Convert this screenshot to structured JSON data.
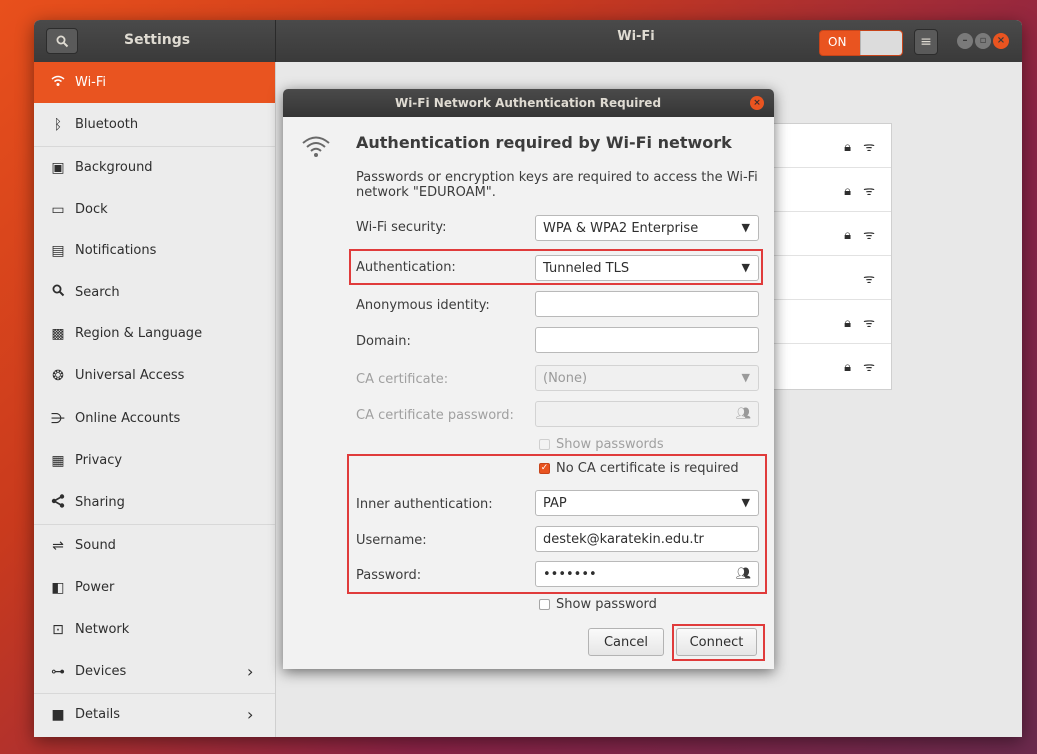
{
  "header": {
    "app_title": "Settings",
    "page_title": "Wi-Fi",
    "switch_label": "ON"
  },
  "sidebar": {
    "items": [
      {
        "label": "Wi-Fi",
        "icon": "wifi-icon"
      },
      {
        "label": "Bluetooth",
        "icon": "bluetooth-icon"
      },
      {
        "label": "Background",
        "icon": "background-icon"
      },
      {
        "label": "Dock",
        "icon": "dock-icon"
      },
      {
        "label": "Notifications",
        "icon": "notifications-icon"
      },
      {
        "label": "Search",
        "icon": "search-icon"
      },
      {
        "label": "Region & Language",
        "icon": "region-icon"
      },
      {
        "label": "Universal Access",
        "icon": "universal-access-icon"
      },
      {
        "label": "Online Accounts",
        "icon": "online-accounts-icon"
      },
      {
        "label": "Privacy",
        "icon": "privacy-icon"
      },
      {
        "label": "Sharing",
        "icon": "sharing-icon"
      },
      {
        "label": "Sound",
        "icon": "sound-icon"
      },
      {
        "label": "Power",
        "icon": "power-icon"
      },
      {
        "label": "Network",
        "icon": "network-icon"
      },
      {
        "label": "Devices",
        "icon": "devices-icon"
      },
      {
        "label": "Details",
        "icon": "details-icon"
      }
    ]
  },
  "dialog": {
    "title": "Wi-Fi Network Authentication Required",
    "heading": "Authentication required by Wi-Fi network",
    "description": "Passwords or encryption keys are required to access the Wi-Fi network \"EDUROAM\".",
    "fields": {
      "wifi_security_label": "Wi-Fi security:",
      "wifi_security_value": "WPA & WPA2 Enterprise",
      "authentication_label": "Authentication:",
      "authentication_value": "Tunneled TLS",
      "anon_identity_label": "Anonymous identity:",
      "anon_identity_value": "",
      "domain_label": "Domain:",
      "domain_value": "",
      "ca_cert_label": "CA certificate:",
      "ca_cert_value": "(None)",
      "ca_cert_password_label": "CA certificate password:",
      "ca_cert_password_value": "",
      "show_passwords_label": "Show passwords",
      "no_ca_label": "No CA certificate is required",
      "inner_auth_label": "Inner authentication:",
      "inner_auth_value": "PAP",
      "username_label": "Username:",
      "username_value": "destek@karatekin.edu.tr",
      "password_label": "Password:",
      "password_value": "•••••••",
      "show_password_label": "Show password"
    },
    "buttons": {
      "cancel": "Cancel",
      "connect": "Connect"
    }
  },
  "colors": {
    "accent": "#e95420",
    "highlight": "#e03b3b"
  }
}
